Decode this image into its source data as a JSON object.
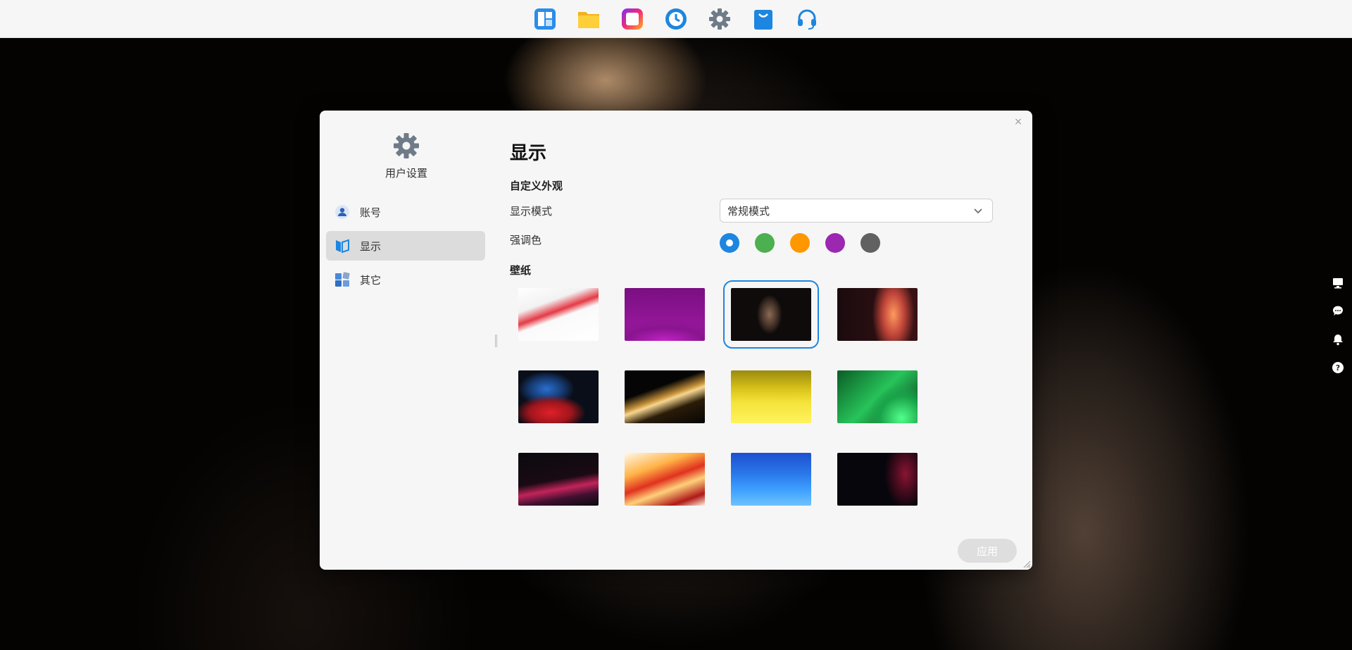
{
  "taskbar": {
    "apps": [
      {
        "icon": "dashboard-app-icon"
      },
      {
        "icon": "file-manager-icon"
      },
      {
        "icon": "photo-app-icon"
      },
      {
        "icon": "backup-clock-icon"
      },
      {
        "icon": "settings-gear-icon"
      },
      {
        "icon": "app-store-bag-icon"
      },
      {
        "icon": "support-headset-icon"
      }
    ]
  },
  "right_rail": {
    "icons": [
      "monitor-icon",
      "chat-icon",
      "bell-icon",
      "help-icon"
    ]
  },
  "window": {
    "close_label": "×",
    "sidebar": {
      "title": "用户设置",
      "items": [
        {
          "label": "账号",
          "icon": "user-icon",
          "active": false
        },
        {
          "label": "显示",
          "icon": "display-icon",
          "active": true
        },
        {
          "label": "其它",
          "icon": "apps-grid-icon",
          "active": false
        }
      ]
    },
    "content": {
      "title": "显示",
      "custom_section": "自定义外观",
      "display_mode_label": "显示模式",
      "display_mode_value": "常规模式",
      "accent_label": "强调色",
      "accent_colors": [
        "#1d86e0",
        "#4caf50",
        "#ff9800",
        "#9c27b0",
        "#616161"
      ],
      "accent_selected_index": 0,
      "wallpaper_section": "壁纸",
      "wallpapers": [
        {
          "name": "red-ribbon-white",
          "bg": "linear-gradient(160deg,#ffffff 0%,#f2f2f2 30%,#e43a45 45%,#fafafa 55%,#ffffff 100%)"
        },
        {
          "name": "purple-waves",
          "bg": "radial-gradient(ellipse 90px 30px at 50% 100%,#c322c6 0%,#8a1490 60%,transparent 100%),linear-gradient(180deg,#7a0f82 0%,#a01aa4 100%)"
        },
        {
          "name": "dark-dog",
          "bg": "radial-gradient(ellipse 18px 28px at 48% 50%,#8a6a55 0%,#3a2a22 70%,transparent 100%),#0e0b0a"
        },
        {
          "name": "orange-glow-dark",
          "bg": "radial-gradient(ellipse 30px 60px at 70% 50%,#ff9a5e 0%,#c0453a 50%,transparent 100%),linear-gradient(90deg,#1a0b0e 0%,#3a1215 100%)"
        },
        {
          "name": "blue-red-smoke",
          "bg": "radial-gradient(ellipse 50px 25px at 40% 80%,#e0202a 0%,#a0151c 60%,transparent 100%),radial-gradient(ellipse 40px 25px at 35% 35%,#2a6fd0 0%,#153a70 60%,transparent 100%),#0a0e18"
        },
        {
          "name": "golden-wave-black",
          "bg": "linear-gradient(160deg,#050505 0%,#050505 35%,#c6913a 50%,#f6d690 55%,#2a1c08 70%,#050505 100%)"
        },
        {
          "name": "yellow-hills",
          "bg": "linear-gradient(180deg,#9a8a10 0%,#d9c31a 35%,#f4e33a 60%,#fff35e 100%)"
        },
        {
          "name": "green-swirl",
          "bg": "radial-gradient(ellipse 60px 60px at 80% 90%,#52ff8a 0%,#1aa44a 50%,transparent 80%),linear-gradient(135deg,#0b5c25 0%,#27c45a 50%,#0a2a14 100%)"
        },
        {
          "name": "pink-streak-dark",
          "bg": "linear-gradient(170deg,#0a0a0f 0%,#1a0a14 50%,#c2245a 65%,#401030 80%,#0a0a0f 100%)"
        },
        {
          "name": "red-orange-silk",
          "bg": "linear-gradient(160deg,#fff8e8 0%,#ffb347 30%,#e0321e 50%,#ffd07a 65%,#b01818 85%,#fff3da 100%)"
        },
        {
          "name": "blue-layers",
          "bg": "linear-gradient(180deg,#1f4fd0 0%,#2a78ea 40%,#3ea0ff 70%,#6dc2ff 100%)"
        },
        {
          "name": "dark-crimson",
          "bg": "radial-gradient(ellipse 30px 50px at 85% 40%,#8a1434 0%,#3a0a1a 60%,transparent 100%),#07060c"
        }
      ],
      "wallpaper_selected_index": 2,
      "apply_label": "应用"
    }
  }
}
